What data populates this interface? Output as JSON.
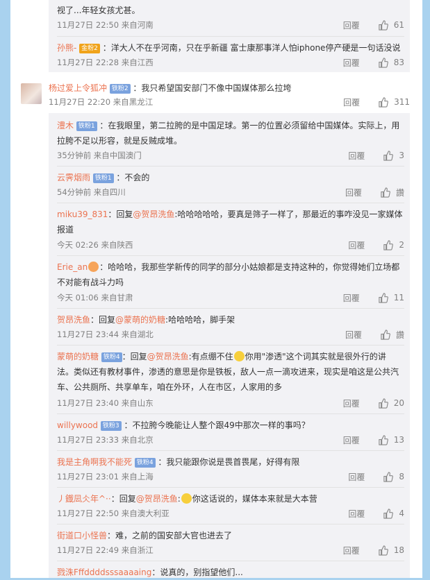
{
  "comments_top": [
    {
      "text_continued": "视了...年轻女孩尤甚。",
      "time": "11月27日 22:50 来自河南",
      "reply": "回覆",
      "likes": "61"
    },
    {
      "name": "孙熊-",
      "badge": "金粉2",
      "text": "：洋大人不在乎河南，只在乎新疆 富士康那事洋人怕iphone停产硬是一句话没说",
      "time": "11月27日 22:28 来自江西",
      "reply": "回覆",
      "likes": "83"
    }
  ],
  "main_comment": {
    "name": "杨过爱上令狐冲",
    "badge": "铁粉2",
    "text": "：我只希望国安部门不像中国媒体那么拉垮",
    "time": "11月27日 22:20 来自黑龙江",
    "reply": "回覆",
    "likes": "311"
  },
  "replies": [
    {
      "name": "澧木",
      "badge": "铁粉1",
      "text1": "：在我眼里，第二拉胯的是中国足球。第一的位置必须留给中国媒体。实际上，用",
      "text2": "拉胯不足以形容，就是反贼成堆。",
      "time": "35分钟前 来自中国澳门",
      "reply": "回覆",
      "likes": "3"
    },
    {
      "name": "云霁烟雨",
      "badge": "铁粉1",
      "text1": "：不会的",
      "time": "54分钟前 来自四川",
      "reply": "回覆",
      "likes": "讚"
    },
    {
      "name": "miku39_831",
      "text1": "：回复",
      "at": "@贺昂洗鱼",
      "text1b": ":哈哈哈哈哈，要真是筛子一样了，那最近的事咋没见一家媒体",
      "text2": "报道",
      "time": "今天 02:26 来自陕西",
      "reply": "回覆",
      "likes": "2"
    },
    {
      "name": "Erie_an",
      "text1": "：哈哈哈，我那些学新传的同学的部分小姑娘都是支持这种的，你觉得她们立场都",
      "text2": "不对能有战斗力吗",
      "time": "今天 01:06 来自甘肃",
      "reply": "回覆",
      "likes": "11"
    },
    {
      "name": "贺昂洗鱼",
      "text1": "：回复",
      "at": "@蒙萌的奶糖",
      "text1b": ":哈哈哈哈，脚手架",
      "time": "11月27日 23:44 来自湖北",
      "reply": "回覆",
      "likes": "讚"
    },
    {
      "name": "蒙萌的奶糖",
      "badge": "铁粉4",
      "text1": "：回复",
      "at": "@贺昂洗鱼",
      "text1b": ":有点绷不住",
      "text1c": "你用\"渗透\"这个词其实就是很外行的讲",
      "text2": "法。类似还有教材事件，渗透的意思是你是铁板，敌人一点一滴攻进来，现实是咱这是公共汽",
      "text3": "车、公共厕所、共享单车，咱在外环，人在市区，人家用的多",
      "time": "11月27日 23:40 来自山东",
      "reply": "回覆",
      "likes": "20"
    },
    {
      "name": "willywood",
      "badge": "铁粉3",
      "text1": "：不拉胯今晚能让人整个跟49中那次一样的事吗？",
      "time": "11月27日 23:33 来自北京",
      "reply": "回覆",
      "likes": "13"
    },
    {
      "name": "我是主角啊我不能死",
      "badge": "铁粉4",
      "text1": "：我只能跟你说是畏首畏尾，好得有限",
      "time": "11月27日 23:01 来自上海",
      "reply": "回覆",
      "likes": "8"
    },
    {
      "name": "丿鐡凨仌年^··",
      "text1": "：回复",
      "at": "@贺昂洗鱼",
      "text1b": ":",
      "text1c": "你这话说的，媒体本来就是大本营",
      "time": "11月27日 22:50 来自澳大利亚",
      "reply": "回覆",
      "likes": "4"
    },
    {
      "name": "街道口小怪兽",
      "text1": "：难，之前的国安部大官也进去了",
      "time": "11月27日 22:49 来自浙江",
      "reply": "回覆",
      "likes": "18"
    },
    {
      "name": "戮洙Fffddddsssaaaaing",
      "text1": "：说真的，别指望他们..."
    }
  ]
}
